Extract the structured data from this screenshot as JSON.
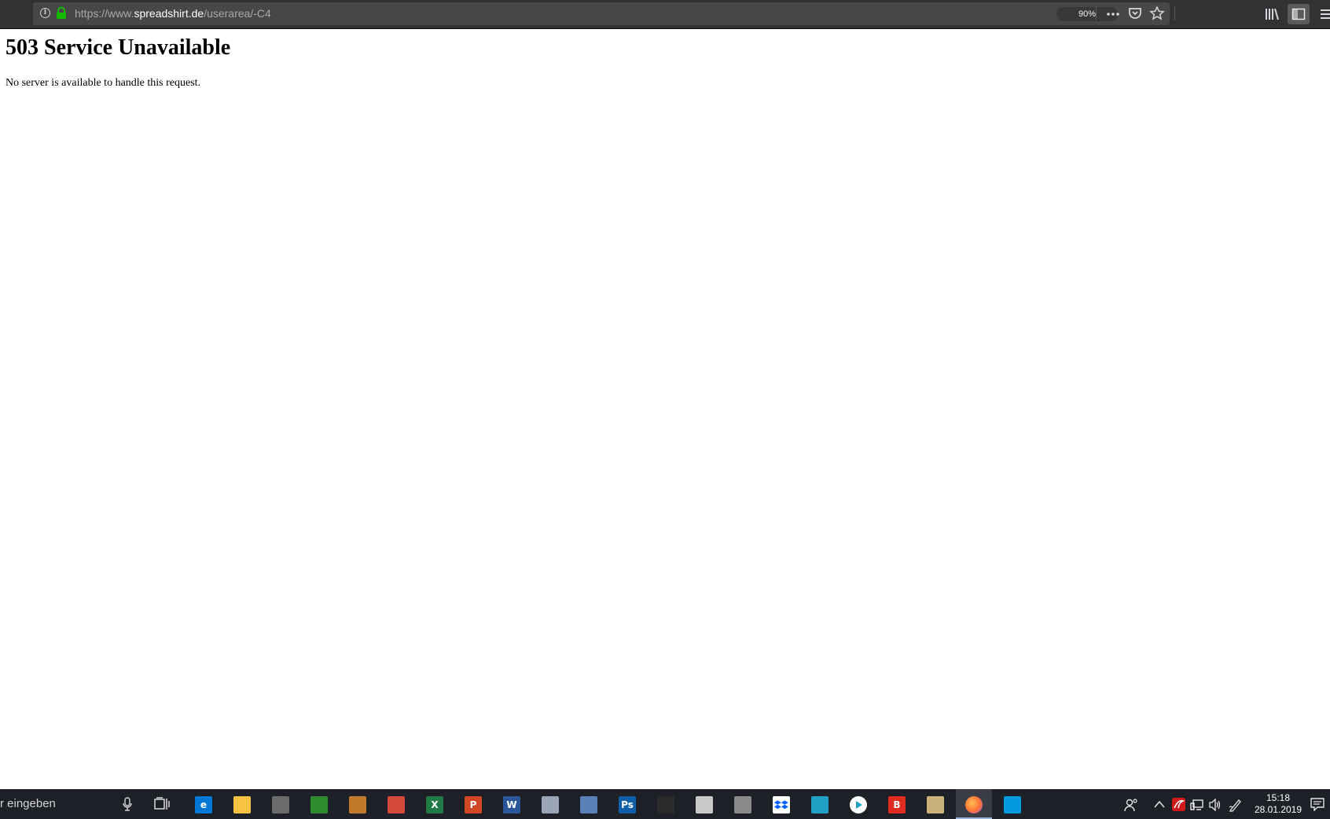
{
  "browser": {
    "url_prefix": "https://www.",
    "url_domain": "spreadshirt.de",
    "url_path": "/userarea/-C4",
    "zoom_level": "90%",
    "icons": [
      "info-icon",
      "lock-icon",
      "more-actions-icon",
      "pocket-icon",
      "bookmark-star-icon",
      "library-icon",
      "sidebar-icon",
      "hamburger-menu-icon"
    ]
  },
  "page": {
    "heading": "503 Service Unavailable",
    "message": "No server is available to handle this request."
  },
  "taskbar": {
    "search_placeholder": "r eingeben",
    "apps": [
      {
        "name": "edge",
        "glyph": "e",
        "color": "#0078d7"
      },
      {
        "name": "file-explorer",
        "glyph": "",
        "color": "#f5c242"
      },
      {
        "name": "app-generic",
        "glyph": "",
        "color": "#6b6b6b"
      },
      {
        "name": "green-app",
        "glyph": "",
        "color": "#2e8b2e"
      },
      {
        "name": "photo-app",
        "glyph": "",
        "color": "#c07a2a"
      },
      {
        "name": "graphic-app",
        "glyph": "",
        "color": "#d34a3a"
      },
      {
        "name": "excel",
        "glyph": "X",
        "color": "#1f7a45"
      },
      {
        "name": "powerpoint",
        "glyph": "P",
        "color": "#d24726"
      },
      {
        "name": "word",
        "glyph": "W",
        "color": "#2b579a"
      },
      {
        "name": "paint-app",
        "glyph": "",
        "color": "#9aa6b8"
      },
      {
        "name": "scan-app",
        "glyph": "",
        "color": "#5b7fb8"
      },
      {
        "name": "photoshop",
        "glyph": "Ps",
        "color": "#0f5ea8"
      },
      {
        "name": "inkscape",
        "glyph": "",
        "color": "#2b2b2b"
      },
      {
        "name": "pdf-app",
        "glyph": "",
        "color": "#c8c8c8"
      },
      {
        "name": "media-app",
        "glyph": "",
        "color": "#8a8a8a"
      },
      {
        "name": "dropbox",
        "glyph": "",
        "color": "#ffffff"
      },
      {
        "name": "sync-app",
        "glyph": "",
        "color": "#1fa0c4"
      },
      {
        "name": "player-app",
        "glyph": "",
        "color": "#ffffff"
      },
      {
        "name": "b-app",
        "glyph": "B",
        "color": "#e02b20"
      },
      {
        "name": "clapper-app",
        "glyph": "",
        "color": "#c9b37a"
      },
      {
        "name": "firefox",
        "glyph": "",
        "color": "#ff7139"
      },
      {
        "name": "store",
        "glyph": "",
        "color": "#0099e0"
      }
    ],
    "tray_icons": [
      "people-icon",
      "chevron-up-icon",
      "antivirus-icon",
      "network-icon",
      "volume-icon",
      "pen-icon"
    ],
    "time": "15:18",
    "date": "28.01.2019"
  }
}
